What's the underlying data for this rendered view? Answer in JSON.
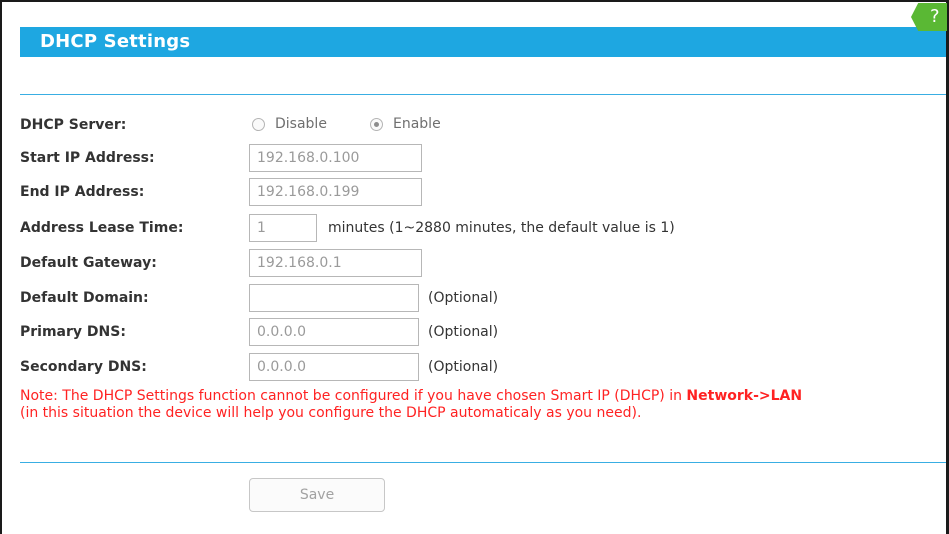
{
  "header": {
    "title": "DHCP Settings",
    "help_glyph": "?"
  },
  "dhcp_server": {
    "label": "DHCP Server:",
    "options": [
      {
        "label": "Disable",
        "checked": false
      },
      {
        "label": "Enable",
        "checked": true
      }
    ]
  },
  "start_ip": {
    "label": "Start IP Address:",
    "value": "192.168.0.100"
  },
  "end_ip": {
    "label": "End IP Address:",
    "value": "192.168.0.199"
  },
  "lease_time": {
    "label": "Address Lease Time:",
    "value": "1",
    "hint": "minutes (1~2880 minutes, the default value is 1)"
  },
  "default_gateway": {
    "label": "Default Gateway:",
    "value": "192.168.0.1"
  },
  "default_domain": {
    "label": "Default Domain:",
    "value": "",
    "hint": "(Optional)"
  },
  "primary_dns": {
    "label": "Primary DNS:",
    "value": "0.0.0.0",
    "hint": "(Optional)"
  },
  "secondary_dns": {
    "label": "Secondary DNS:",
    "value": "0.0.0.0",
    "hint": "(Optional)"
  },
  "note": {
    "line1_text": "Note: The DHCP Settings function cannot be configured if you have chosen Smart IP (DHCP) in ",
    "line1_link": "Network->LAN",
    "line2_text": "(in this situation the device will help you configure the DHCP automaticaly as you need)."
  },
  "save_button": {
    "label": "Save"
  },
  "colors": {
    "header_bg": "#1ea7e1",
    "help_badge": "#5ab834",
    "divider": "#39aee3",
    "note_text": "#ff2222"
  }
}
